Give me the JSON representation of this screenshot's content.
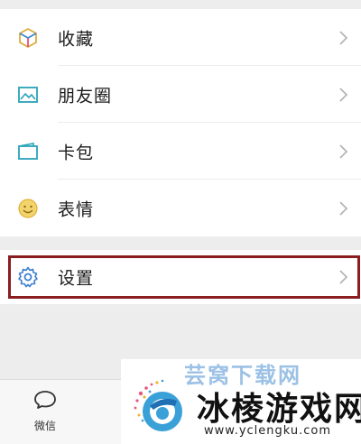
{
  "menu": {
    "items": [
      {
        "label": "收藏",
        "icon": "favorites-cube-icon"
      },
      {
        "label": "朋友圈",
        "icon": "moments-image-icon"
      },
      {
        "label": "卡包",
        "icon": "card-wallet-icon"
      },
      {
        "label": "表情",
        "icon": "sticker-smiley-icon"
      }
    ],
    "settings": {
      "label": "设置",
      "icon": "gear-icon"
    }
  },
  "tabbar": {
    "tabs": [
      {
        "label": "微信",
        "icon": "chat-bubble-icon"
      }
    ]
  },
  "watermark": {
    "top_text": "芸窝下载网",
    "title": "冰棱游戏网",
    "url": "www.yclengku.com"
  },
  "colors": {
    "accent_teal": "#2aa3b8",
    "highlight_border": "#8a1d1d",
    "background": "#ededed"
  }
}
